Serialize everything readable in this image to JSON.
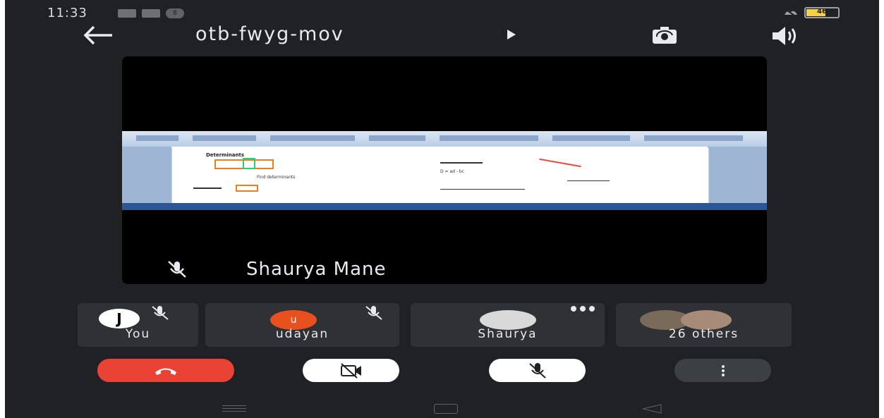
{
  "status_bar": {
    "time": "11:33",
    "notification_count": "8",
    "battery_level": "46"
  },
  "header": {
    "meeting_code": "otb-fwyg-mov"
  },
  "main_tile": {
    "speaker_name": "Shaurya Mane",
    "shared_screen": {
      "title": "Determinants",
      "text_1": "Find determinants",
      "text_2": "D = ad - bc"
    }
  },
  "participants": [
    {
      "label": "You",
      "avatar_text": "J"
    },
    {
      "label": "udayan",
      "avatar_text": "u"
    },
    {
      "label": "Shaurya",
      "avatar_text": ""
    },
    {
      "label": "26 others",
      "avatar_text": ""
    }
  ],
  "controls": {
    "end_call_color": "#ea4335",
    "toggle_color": "#ffffff",
    "more_color": "#3c4043"
  }
}
